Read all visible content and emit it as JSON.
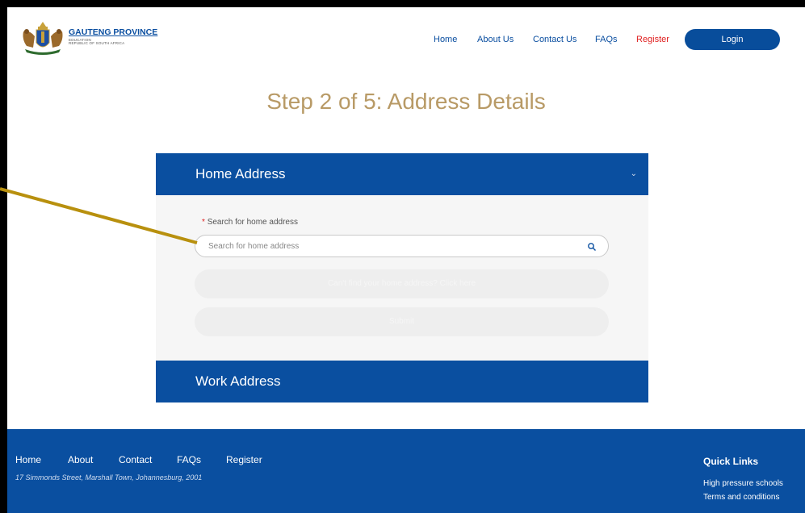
{
  "header": {
    "logo": {
      "name": "GAUTENG PROVINCE",
      "sub_line1": "EDUCATION",
      "sub_line2": "REPUBLIC OF SOUTH AFRICA"
    },
    "nav": [
      "Home",
      "About Us",
      "Contact Us",
      "FAQs",
      "Register"
    ],
    "login_label": "Login"
  },
  "page_title": "Step 2 of 5: Address Details",
  "home_address": {
    "heading": "Home Address",
    "search_label": "Search for home address",
    "required_mark": "*",
    "search_placeholder": "Search for home address",
    "cant_find_label": "Can't find your home address? Click here",
    "submit_label": "Submit"
  },
  "work_address": {
    "heading": "Work Address"
  },
  "footer": {
    "nav": [
      "Home",
      "About",
      "Contact",
      "FAQs",
      "Register"
    ],
    "address": "17 Simmonds Street, Marshall Town, Johannesburg, 2001",
    "quick_links_title": "Quick Links",
    "quick_links": [
      "High pressure schools",
      "Terms and conditions"
    ]
  },
  "colors": {
    "brand_blue": "#0a4fa0",
    "title_gold": "#b89a66",
    "register_red": "#e02020",
    "annotation": "#b8900e"
  },
  "icons": [
    "crest-icon",
    "chevron-down-icon",
    "search-icon"
  ]
}
